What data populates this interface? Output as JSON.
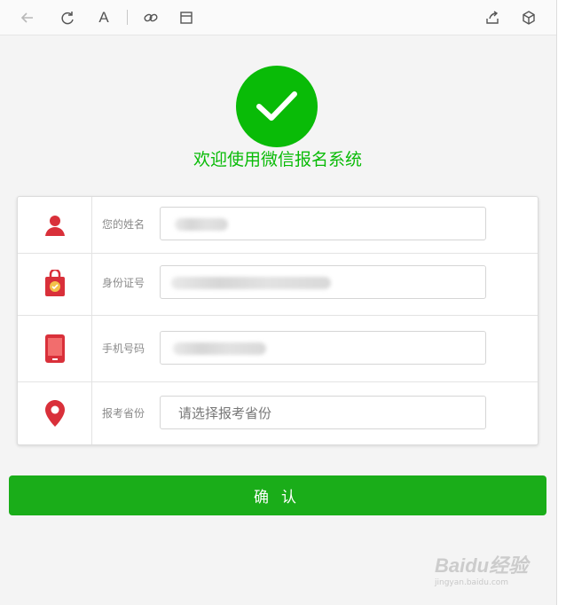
{
  "toolbar": {
    "icons": [
      "back-arrow-icon",
      "refresh-icon",
      "text-font-icon",
      "link-icon",
      "window-icon",
      "share-icon",
      "cube-icon"
    ],
    "font_glyph": "A"
  },
  "header": {
    "welcome_text": "欢迎使用微信报名系统"
  },
  "form": {
    "rows": [
      {
        "label": "您的姓名",
        "value": "",
        "placeholder": ""
      },
      {
        "label": "身份证号",
        "value": "",
        "placeholder": ""
      },
      {
        "label": "手机号码",
        "value": "",
        "placeholder": ""
      },
      {
        "label": "报考省份",
        "value": "",
        "placeholder": "请选择报考省份"
      }
    ]
  },
  "confirm_button": {
    "label": "确认"
  },
  "watermark": {
    "brand": "Baidu经验",
    "url": "jingyan.baidu.com"
  },
  "colors": {
    "success_green": "#09bb07",
    "button_green": "#1aad19",
    "icon_red": "#d9303a"
  }
}
